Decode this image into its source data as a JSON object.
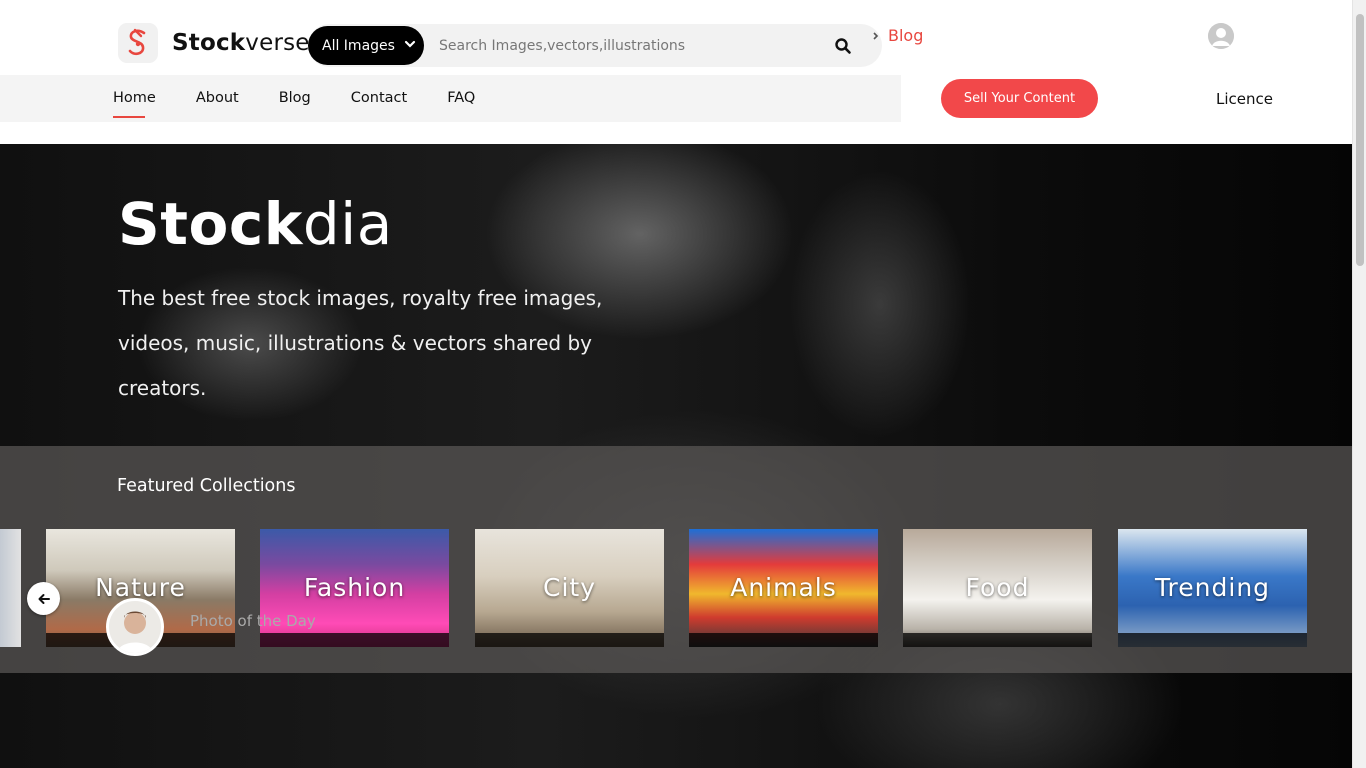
{
  "brand": {
    "name_bold": "Stock",
    "name_light": "verse",
    "logo_icon": "stockverse-s-logo-icon",
    "accent": "#e8473f"
  },
  "search": {
    "category": "All Images",
    "placeholder": "Search Images,vectors,illustrations",
    "icon": "search-icon"
  },
  "top_link": "Blog",
  "nav": {
    "items": [
      {
        "label": "Home",
        "active": true
      },
      {
        "label": "About"
      },
      {
        "label": "Blog"
      },
      {
        "label": "Contact"
      },
      {
        "label": "FAQ"
      }
    ]
  },
  "actions": {
    "sell_label": "Sell Your Content",
    "licence_label": "Licence"
  },
  "hero": {
    "title_bold": "Stock",
    "title_light": "dia",
    "description": "The best free stock images, royalty free images, videos, music, illustrations & vectors shared by creators."
  },
  "featured": {
    "title": "Featured Collections",
    "collections": [
      {
        "label": "Nature"
      },
      {
        "label": "Fashion"
      },
      {
        "label": "City"
      },
      {
        "label": "Animals"
      },
      {
        "label": "Food"
      },
      {
        "label": "Trending"
      }
    ]
  },
  "photo_of_day": {
    "label": "Photo of the Day"
  }
}
